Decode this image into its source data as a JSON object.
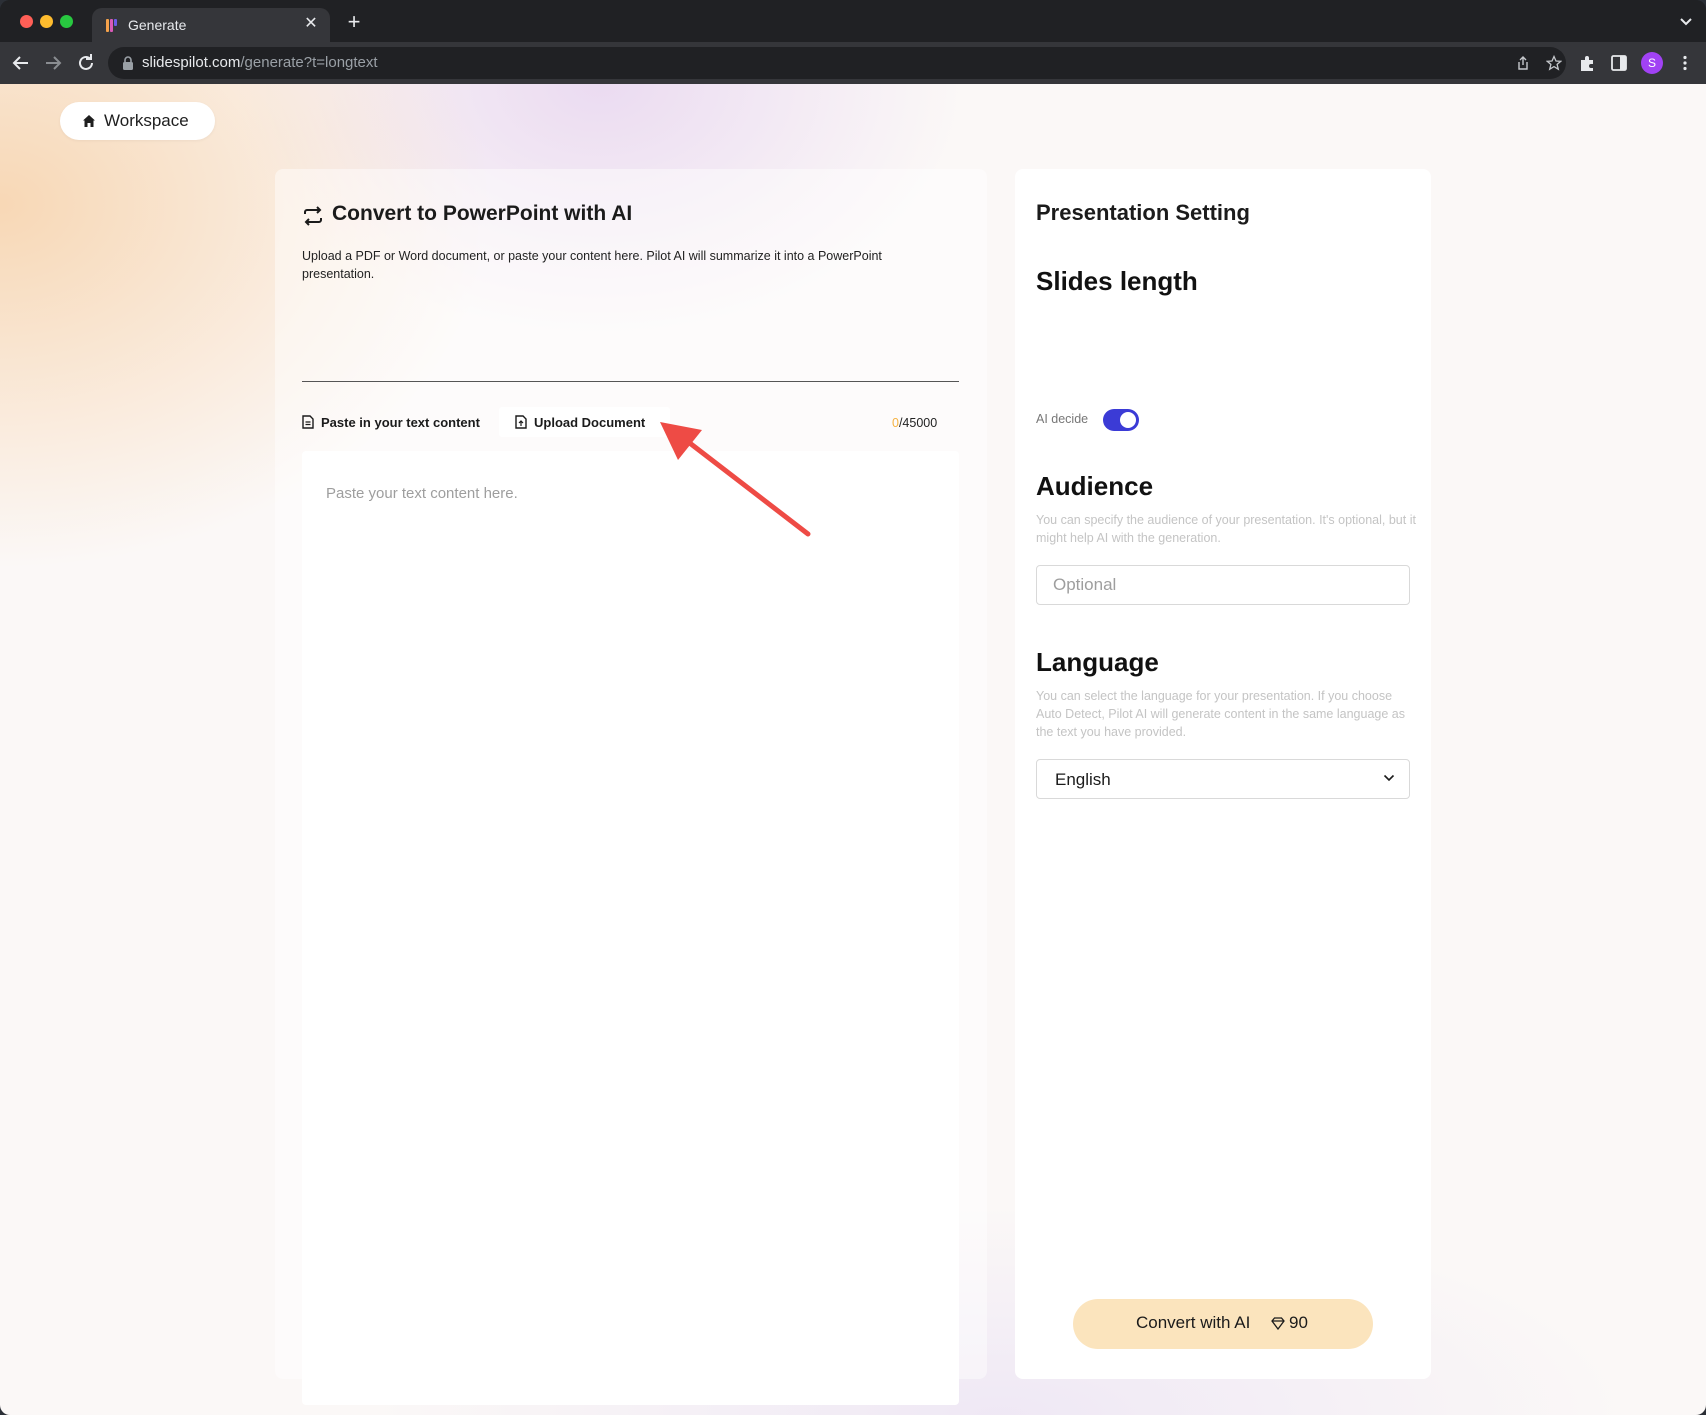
{
  "browser": {
    "tab_title": "Generate",
    "url_host": "slidespilot.com",
    "url_path": "/generate?t=longtext",
    "profile_initial": "S"
  },
  "workspace": {
    "label": "Workspace"
  },
  "converter": {
    "title": "Convert to PowerPoint with AI",
    "description": "Upload a PDF or Word document, or paste your content here. Pilot AI will summarize it into a PowerPoint presentation.",
    "tabs": [
      {
        "label": "Paste in your text content",
        "icon": "document-icon"
      },
      {
        "label": "Upload Document",
        "icon": "upload-file-icon"
      }
    ],
    "char_count_used": "0",
    "char_count_max": "/45000",
    "text_placeholder": "Paste your text content here."
  },
  "settings": {
    "heading": "Presentation Setting",
    "slides_length": {
      "title": "Slides length",
      "toggle_label": "AI decide",
      "toggle_on": true
    },
    "audience": {
      "title": "Audience",
      "description": "You can specify the audience of your presentation. It's optional, but it might help AI with the generation.",
      "placeholder": "Optional"
    },
    "language": {
      "title": "Language",
      "description": "You can select the language for your presentation. If you choose Auto Detect, Pilot AI will generate content in the same language as the text you have provided.",
      "selected": "English"
    },
    "convert_button": {
      "label": "Convert with AI",
      "credits": "90"
    }
  },
  "colors": {
    "accent": "#3b3bd6",
    "convert_button_bg": "#fbe4bd",
    "annotation_arrow": "#ee4b45"
  }
}
